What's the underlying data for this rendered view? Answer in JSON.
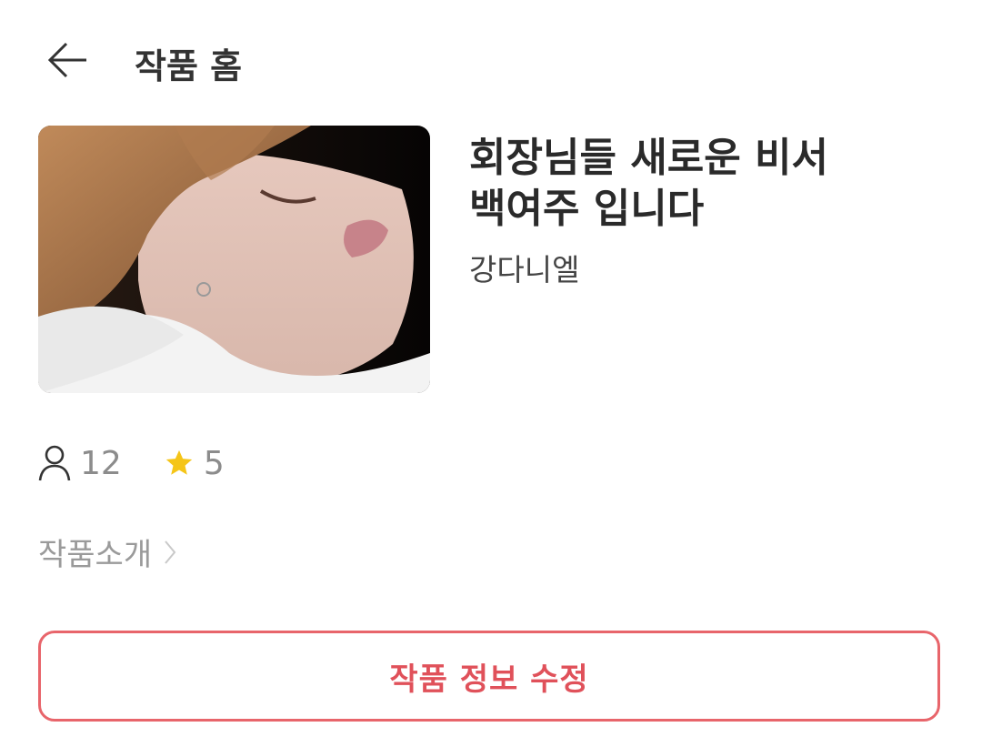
{
  "header": {
    "title": "작품 홈",
    "back_icon": "arrow-left-icon"
  },
  "work": {
    "title_line1": "회장님들 새로운 비서",
    "title_line2": "백여주 입니다",
    "author": "강다니엘"
  },
  "stats": {
    "readers": "12",
    "readers_icon": "person-icon",
    "rating": "5",
    "rating_icon": "star-icon",
    "star_color": "#f5c518"
  },
  "intro": {
    "label": "작품소개",
    "icon": "chevron-right-icon"
  },
  "edit_button": {
    "label": "작품 정보 수정",
    "color": "#e8656b"
  }
}
